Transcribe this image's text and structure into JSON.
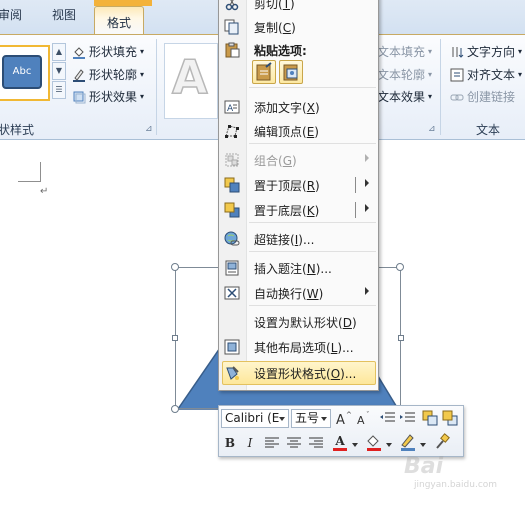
{
  "ribbon": {
    "tabs": [
      {
        "label": "审阅"
      },
      {
        "label": "视图"
      },
      {
        "label": "格式",
        "active": true
      }
    ],
    "shape_styles": {
      "group_label": "状样式",
      "swatch_text": "Abc",
      "fill_label": "形状填充",
      "outline_label": "形状轮廓",
      "effects_label": "形状效果"
    },
    "wordart": {
      "glyph": "A",
      "text_fill_label": "文本填充",
      "text_outline_label": "文本轮廓",
      "text_effects_label": "文本效果"
    },
    "text_group": {
      "group_label": "文本",
      "direction_label": "文字方向",
      "align_label": "对齐文本",
      "link_label": "创建链接"
    }
  },
  "context_menu": {
    "items": [
      {
        "label": "剪切",
        "key": "T",
        "icon": "scissors-icon"
      },
      {
        "label": "复制",
        "key": "C",
        "icon": "copy-icon"
      },
      {
        "paste_header": "粘贴选项:"
      },
      {
        "label": "添加文字",
        "key": "X",
        "icon": "add-text-icon"
      },
      {
        "label": "编辑顶点",
        "key": "E",
        "icon": "edit-points-icon"
      },
      {
        "label": "组合",
        "key": "G",
        "icon": "group-icon",
        "disabled": true
      },
      {
        "label": "置于顶层",
        "key": "R",
        "icon": "bring-front-icon"
      },
      {
        "label": "置于底层",
        "key": "K",
        "icon": "send-back-icon"
      },
      {
        "label": "超链接",
        "key": "I",
        "icon": "hyperlink-icon",
        "suffix": "..."
      },
      {
        "label": "插入题注",
        "key": "N",
        "icon": "caption-icon",
        "suffix": "..."
      },
      {
        "label": "自动换行",
        "key": "W",
        "icon": "wrap-icon"
      },
      {
        "label": "设置为默认形状",
        "key": "D"
      },
      {
        "label": "其他布局选项",
        "key": "L",
        "icon": "layout-icon",
        "suffix": "..."
      },
      {
        "label": "设置形状格式",
        "key": "O",
        "icon": "format-shape-icon",
        "suffix": "..."
      }
    ]
  },
  "mini_toolbar": {
    "font_name": "Calibri (E",
    "font_size": "五号",
    "bold": "B",
    "italic": "I",
    "font_color_glyph": "A"
  },
  "watermark": {
    "text": "Bai",
    "sub": "jingyan.baidu.com"
  },
  "colors": {
    "accent_orange": "#f3b23a",
    "shape_blue": "#4f81bd",
    "highlight": "#fde79a"
  }
}
